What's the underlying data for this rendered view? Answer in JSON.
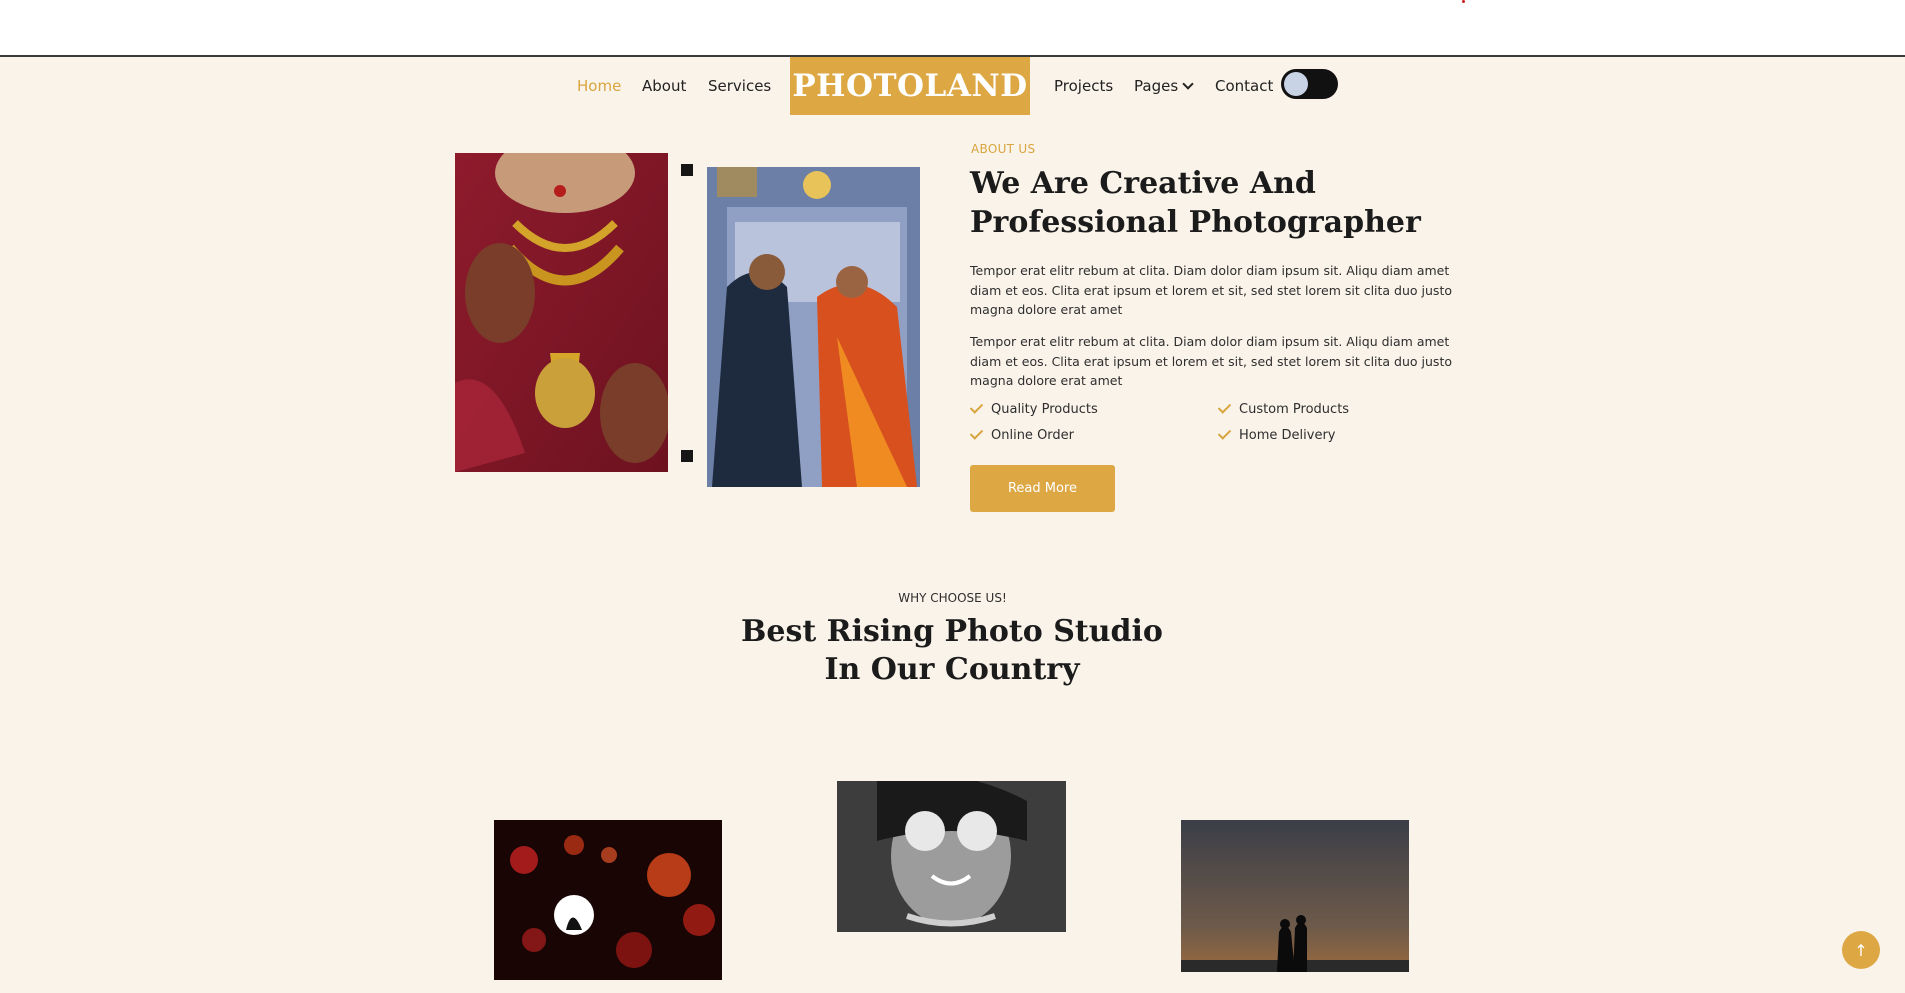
{
  "nav": {
    "items_left": [
      "Home",
      "About",
      "Services"
    ],
    "brand": "PHOTOLAND",
    "items_right": [
      "Projects",
      "Pages",
      "Contact"
    ]
  },
  "about": {
    "label": "ABOUT US",
    "heading": "We Are Creative And Professional Photographer",
    "paragraphs": [
      "Tempor erat elitr rebum at clita. Diam dolor diam ipsum sit. Aliqu diam amet diam et eos. Clita erat ipsum et lorem et sit, sed stet lorem sit clita duo justo magna dolore erat amet",
      "Tempor erat elitr rebum at clita. Diam dolor diam ipsum sit. Aliqu diam amet diam et eos. Clita erat ipsum et lorem et sit, sed stet lorem sit clita duo justo magna dolore erat amet"
    ],
    "features": [
      "Quality Products",
      "Custom Products",
      "Online Order",
      "Home Delivery"
    ],
    "button": "Read More"
  },
  "why": {
    "label": "WHY CHOOSE US!",
    "heading_line1": "Best Rising Photo Studio",
    "heading_line2": "In Our Country"
  },
  "colors": {
    "accent": "#dda843",
    "background": "#faf3ea",
    "text": "#1b1b1b"
  },
  "icons": {
    "check": "check-icon",
    "caret": "chevron-down-icon",
    "back_to_top": "arrow-up-icon"
  }
}
